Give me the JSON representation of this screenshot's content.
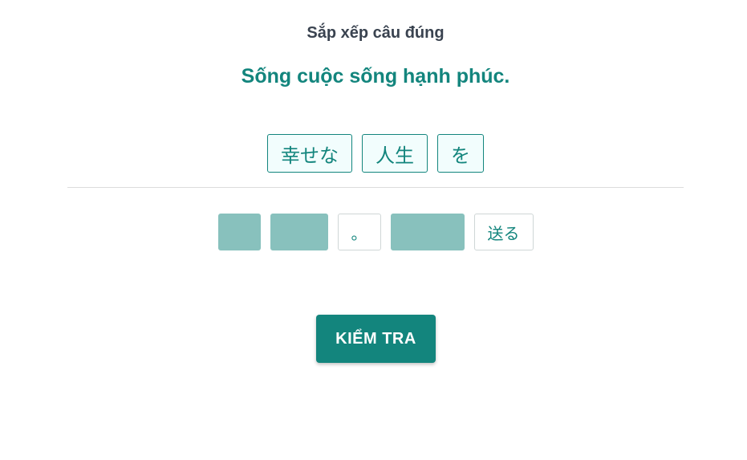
{
  "exercise": {
    "instruction": "Sắp xếp câu đúng",
    "prompt": "Sống cuộc sống hạnh phúc."
  },
  "answer_tiles": [
    {
      "text": "幸せな"
    },
    {
      "text": "人生"
    },
    {
      "text": "を"
    }
  ],
  "word_bank": [
    {
      "text": "",
      "state": "used"
    },
    {
      "text": "",
      "state": "used"
    },
    {
      "text": "。",
      "state": "available"
    },
    {
      "text": "",
      "state": "used"
    },
    {
      "text": "送る",
      "state": "available"
    }
  ],
  "check_button": {
    "label": "KIỂM TRA"
  },
  "colors": {
    "accent": "#13857d",
    "used_tile": "#88c1bd",
    "instruction_text": "#3a4350"
  }
}
